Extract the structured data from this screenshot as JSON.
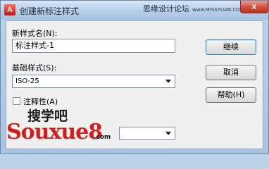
{
  "window": {
    "title": "创建新标注样式",
    "close_label": "x",
    "app_icon": "A"
  },
  "watermark_top": {
    "text": "思缘设计论坛",
    "url": "www.MISSYUAN.COM"
  },
  "form": {
    "new_name_label": "新样式名(N):",
    "new_name_value": "标注样式-1",
    "base_style_label": "基础样式(S):",
    "base_style_value": "ISO-25",
    "annotative_label": "注释性(A)",
    "annotative_checked": false
  },
  "buttons": {
    "continue": "继续",
    "cancel": "取消",
    "help": "帮助(H)"
  },
  "watermark": {
    "cn": "搜学吧",
    "en": "Souxue8",
    "en_suffix": ".com"
  }
}
